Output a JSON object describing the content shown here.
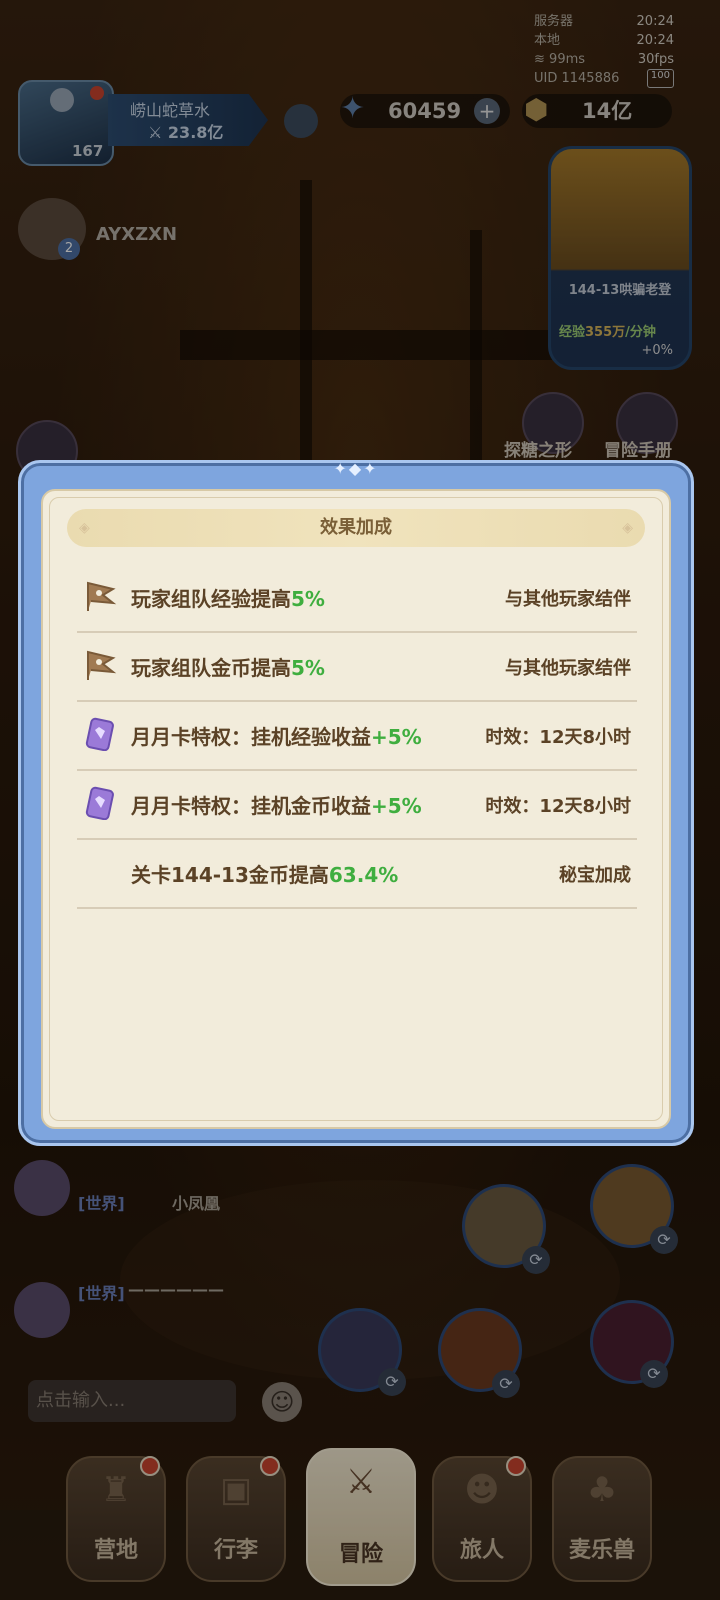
{
  "status": {
    "server_label": "服务器",
    "server_time": "20:24",
    "local_label": "本地",
    "local_time": "20:24",
    "ping": "99ms",
    "fps": "30fps",
    "uid": "UID 1145886",
    "battery": "100"
  },
  "player": {
    "level": "167",
    "name": "崂山蛇草水",
    "power": "23.8亿"
  },
  "currency": {
    "gems": "60459",
    "gold": "14亿"
  },
  "ally": {
    "name": "AYXZXN",
    "badge": "2"
  },
  "stage_card": {
    "title": "144-13哄骗老登",
    "exp_label": "经验",
    "exp_value": "355万",
    "exp_unit": "/分钟",
    "bonus": "+0%"
  },
  "side_buttons": {
    "left_label": "探糖之形",
    "right_label": "冒险手册"
  },
  "modal": {
    "title": "效果加成",
    "top_deco": "✦◆✦",
    "rows": [
      {
        "text": "玩家组队经验提高",
        "pct": "5%",
        "source": "与其他玩家结伴",
        "icon": "flag-icon"
      },
      {
        "text": "玩家组队金币提高",
        "pct": "5%",
        "source": "与其他玩家结伴",
        "icon": "flag-icon"
      },
      {
        "text": "月月卡特权：挂机经验收益",
        "pct": "+5%",
        "source": "时效：12天8小时",
        "icon": "card-icon"
      },
      {
        "text": "月月卡特权：挂机金币收益",
        "pct": "+5%",
        "source": "时效：12天8小时",
        "icon": "card-icon"
      },
      {
        "text": "关卡144-13金币提高",
        "pct": "63.4%",
        "source": "秘宝加成",
        "icon": ""
      }
    ]
  },
  "chat": {
    "messages": [
      {
        "tag": "[世界]",
        "name": "小凤凰"
      },
      {
        "tag": "[世界]",
        "name": "——————"
      }
    ],
    "input_placeholder": "点击输入..."
  },
  "nav": {
    "items": [
      {
        "label": "营地",
        "badge": true
      },
      {
        "label": "行李",
        "badge": true
      },
      {
        "label": "冒险",
        "badge": false,
        "active": true
      },
      {
        "label": "旅人",
        "badge": true
      },
      {
        "label": "麦乐兽",
        "badge": false
      }
    ]
  },
  "colors": {
    "accent_green": "#3fae3f",
    "modal_frame": "#7ea5de",
    "modal_body": "#f2ecdb",
    "text_brown": "#5b4226"
  }
}
